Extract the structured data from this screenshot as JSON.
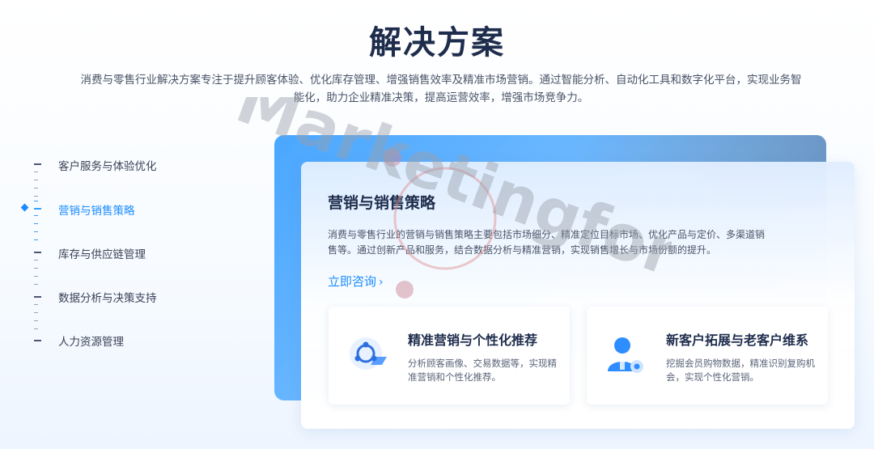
{
  "header": {
    "title": "解决方案",
    "description": "消费与零售行业解决方案专注于提升顾客体验、优化库存管理、增强销售效率及精准市场营销。通过智能分析、自动化工具和数字化平台，实现业务智能化，助力企业精准决策，提高运营效率，增强市场竞争力。"
  },
  "nav": {
    "items": [
      {
        "label": "客户服务与体验优化"
      },
      {
        "label": "营销与销售策略"
      },
      {
        "label": "库存与供应链管理"
      },
      {
        "label": "数据分析与决策支持"
      },
      {
        "label": "人力资源管理"
      }
    ],
    "active_index": 1
  },
  "card": {
    "title": "营销与销售策略",
    "description": "消费与零售行业的营销与销售策略主要包括市场细分、精准定位目标市场、优化产品与定价、多渠道销售等。通过创新产品和服务，结合数据分析与精准营销，实现销售增长与市场份额的提升。",
    "consult_label": "立即咨询",
    "features": [
      {
        "title": "精准营销与个性化推荐",
        "description": "分析顾客画像、交易数据等，实现精准营销和个性化推荐。",
        "icon": "share-network-icon"
      },
      {
        "title": "新客户拓展与老客户维系",
        "description": "挖掘会员购物数据，精准识别复购机会，实现个性化营销。",
        "icon": "customer-service-icon"
      }
    ]
  },
  "watermark": {
    "text": "Marketingforce"
  },
  "colors": {
    "accent": "#1a8cff",
    "title": "#1f2d4d",
    "panel": "#4aa7ff"
  }
}
